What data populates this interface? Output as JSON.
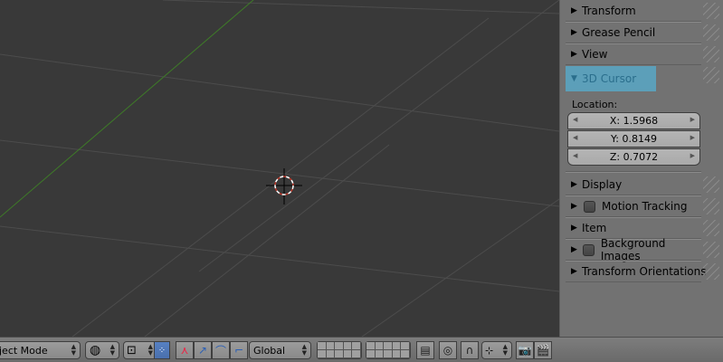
{
  "properties_panel": {
    "sections_top": [
      {
        "label": "Transform",
        "expanded": false
      },
      {
        "label": "Grease Pencil",
        "expanded": false
      },
      {
        "label": "View",
        "expanded": false
      }
    ],
    "cursor_section": {
      "label": "3D Cursor",
      "expanded": true,
      "location_label": "Location:",
      "x": "X: 1.5968",
      "y": "Y: 0.8149",
      "z": "Z: 0.7072"
    },
    "sections_bottom": [
      {
        "label": "Display",
        "has_checkbox": false
      },
      {
        "label": "Motion Tracking",
        "has_checkbox": true
      },
      {
        "label": "Item",
        "has_checkbox": false
      },
      {
        "label": "Background Images",
        "has_checkbox": true
      },
      {
        "label": "Transform Orientations",
        "has_checkbox": false
      }
    ]
  },
  "header": {
    "mode": "ject Mode",
    "orientation": "Global"
  },
  "colors": {
    "accent_selected": "#5c9fb9",
    "viewport_bg": "#393939",
    "panel_bg": "#727272",
    "cursor_ring": "#c0392b"
  },
  "icons": [
    "triangle-right-icon",
    "triangle-down-icon",
    "globe-icon",
    "pivot-icon",
    "manipulator-icon",
    "translate-icon",
    "rotate-icon",
    "scale-icon",
    "layers-icon",
    "render-icon",
    "snap-icon",
    "camera-icon",
    "clapper-icon"
  ]
}
